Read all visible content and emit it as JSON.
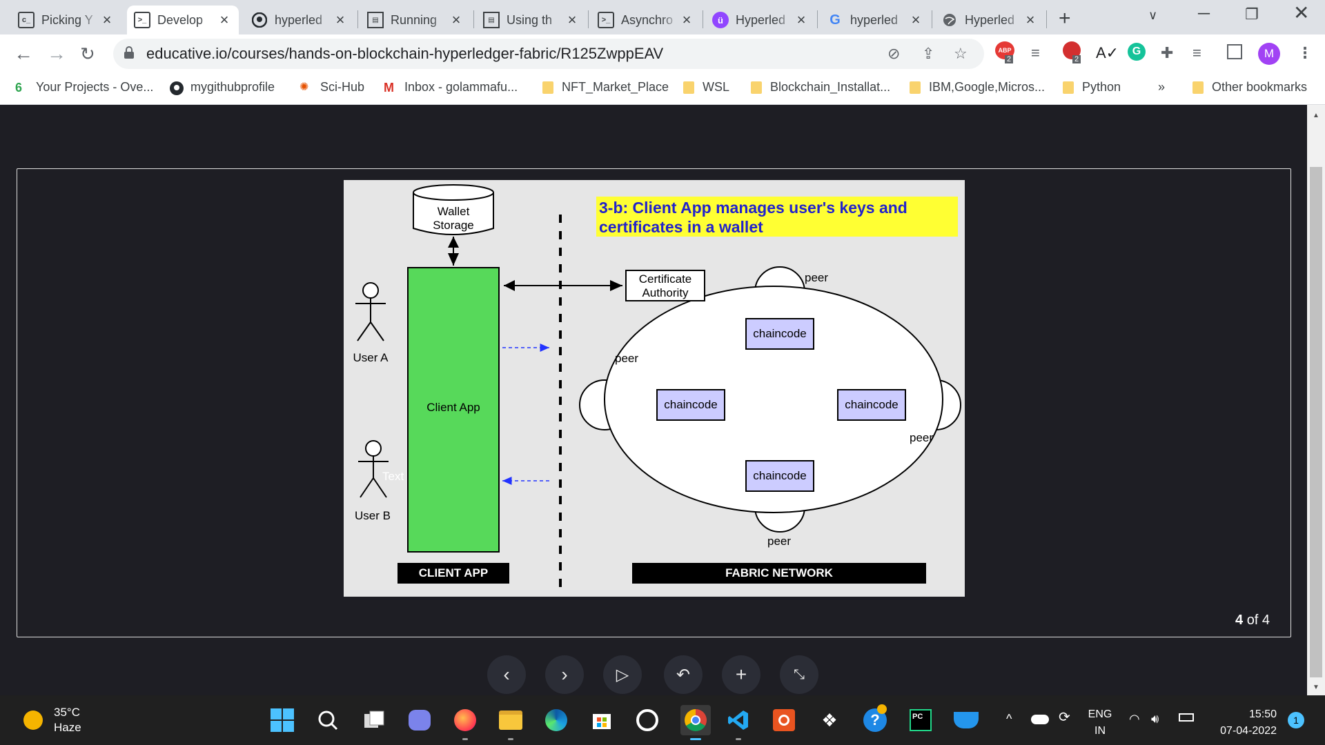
{
  "browser": {
    "tabs": [
      {
        "title": "Picking Y",
        "icon": "terminal-icon",
        "active": false
      },
      {
        "title": "Develop",
        "icon": "terminal-icon",
        "active": true
      },
      {
        "title": "hyperled",
        "icon": "github-icon",
        "active": false
      },
      {
        "title": "Running",
        "icon": "book-icon",
        "active": false
      },
      {
        "title": "Using th",
        "icon": "book-icon",
        "active": false
      },
      {
        "title": "Asynchro",
        "icon": "terminal-icon",
        "active": false
      },
      {
        "title": "Hyperled",
        "icon": "hyperledger-icon",
        "active": false
      },
      {
        "title": "hyperled",
        "icon": "google-icon",
        "active": false
      },
      {
        "title": "Hyperled",
        "icon": "globe-icon",
        "active": false
      }
    ],
    "new_tab": "+",
    "url": "educative.io/courses/hands-on-blockchain-hyperledger-fabric/R125ZwppEAV",
    "extension_badges": {
      "abp": "ABP",
      "abp_count": "2",
      "ext_count": "2"
    },
    "profile_initial": "M",
    "bookmarks": [
      {
        "label": "Your Projects - Ove...",
        "icon": "codeql-icon"
      },
      {
        "label": "mygithubprofile",
        "icon": "github-icon"
      },
      {
        "label": "Sci-Hub",
        "icon": "scihub-icon"
      },
      {
        "label": "Inbox - golammafu...",
        "icon": "gmail-icon"
      },
      {
        "label": "NFT_Market_Place",
        "icon": "folder-icon"
      },
      {
        "label": "WSL",
        "icon": "folder-icon"
      },
      {
        "label": "Blockchain_Installat...",
        "icon": "folder-icon"
      },
      {
        "label": "IBM,Google,Micros...",
        "icon": "folder-icon"
      },
      {
        "label": "Python",
        "icon": "folder-icon"
      }
    ],
    "bookmarks_more": "»",
    "other_bookmarks": "Other bookmarks"
  },
  "slide": {
    "wallet_storage": "Wallet\nStorage",
    "wallet_line1": "Wallet",
    "wallet_line2": "Storage",
    "user_a": "User A",
    "user_b": "User B",
    "faint_text": "Text",
    "client_app": "Client App",
    "client_app_bar": "CLIENT APP",
    "title_line1": "3-b: Client App manages user's keys and",
    "title_line2": "certificates in a wallet",
    "ca_line1": "Certificate",
    "ca_line2": "Authority",
    "peer": "peer",
    "chaincode": "chaincode",
    "fabric_bar": "FABRIC NETWORK"
  },
  "viewer": {
    "page_current": "4",
    "page_total": "of 4",
    "controls": [
      "chevron-left-icon",
      "chevron-right-icon",
      "play-icon",
      "undo-icon",
      "plus-icon",
      "collapse-icon"
    ]
  },
  "taskbar": {
    "weather_temp": "35°C",
    "weather_desc": "Haze",
    "lang_line1": "ENG",
    "lang_line2": "IN",
    "time": "15:50",
    "date": "07-04-2022",
    "notification_count": "1"
  }
}
